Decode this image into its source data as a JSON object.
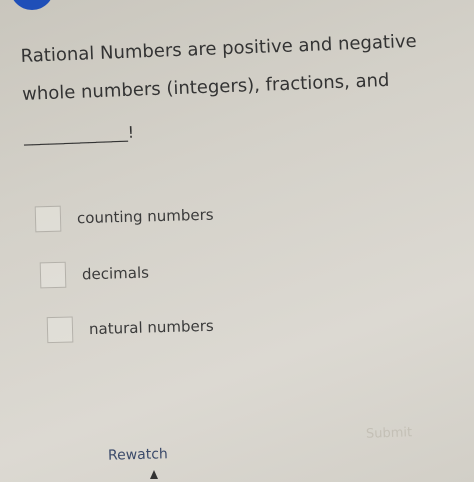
{
  "question": {
    "line1": "Rational Numbers are positive and negative",
    "line2": "whole numbers (integers), fractions, and",
    "blank": "_____________!"
  },
  "options": [
    {
      "label": "counting numbers",
      "checked": false
    },
    {
      "label": "decimals",
      "checked": false
    },
    {
      "label": "natural numbers",
      "checked": false
    }
  ],
  "actions": {
    "rewatch_label": "Rewatch",
    "submit_label": "Submit"
  },
  "colors": {
    "badge": "#1f4fb8",
    "rewatch_text": "#3b4a6a",
    "submit_text_disabled": "#c4c0b6"
  }
}
